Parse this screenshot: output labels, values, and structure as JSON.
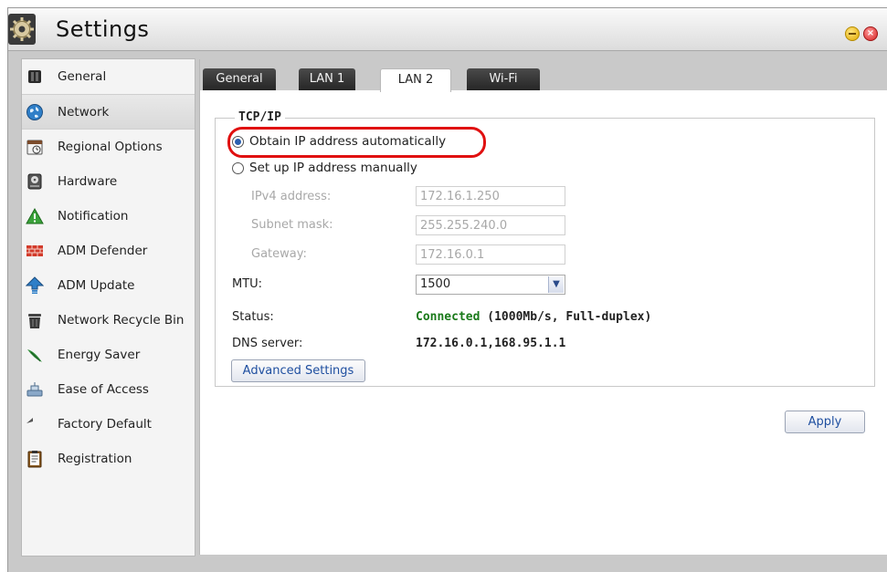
{
  "window": {
    "title": "Settings"
  },
  "sidebar": {
    "items": [
      {
        "label": "General",
        "icon": "server-icon",
        "active": false
      },
      {
        "label": "Network",
        "icon": "globe-icon",
        "active": true
      },
      {
        "label": "Regional Options",
        "icon": "clock-icon",
        "active": false
      },
      {
        "label": "Hardware",
        "icon": "disk-icon",
        "active": false
      },
      {
        "label": "Notification",
        "icon": "warning-icon",
        "active": false
      },
      {
        "label": "ADM Defender",
        "icon": "firewall-icon",
        "active": false
      },
      {
        "label": "ADM Update",
        "icon": "up-arrow-icon",
        "active": false
      },
      {
        "label": "Network Recycle Bin",
        "icon": "trash-icon",
        "active": false
      },
      {
        "label": "Energy Saver",
        "icon": "leaf-icon",
        "active": false
      },
      {
        "label": "Ease of Access",
        "icon": "router-icon",
        "active": false
      },
      {
        "label": "Factory Default",
        "icon": "undo-arrow-icon",
        "active": false
      },
      {
        "label": "Registration",
        "icon": "clipboard-icon",
        "active": false
      }
    ]
  },
  "tabs": [
    {
      "label": "General",
      "active": false
    },
    {
      "label": "LAN 1",
      "active": false
    },
    {
      "label": "LAN 2",
      "active": true
    },
    {
      "label": "Wi-Fi",
      "active": false
    }
  ],
  "tcpip": {
    "legend": "TCP/IP",
    "auto_label": "Obtain IP address automatically",
    "auto_selected": true,
    "manual_label": "Set up IP address manually",
    "ipv4_label": "IPv4 address:",
    "ipv4_value": "172.16.1.250",
    "subnet_label": "Subnet mask:",
    "subnet_value": "255.255.240.0",
    "gateway_label": "Gateway:",
    "gateway_value": "172.16.0.1",
    "mtu_label": "MTU:",
    "mtu_value": "1500",
    "status_label": "Status:",
    "status_connected": "Connected",
    "status_detail": "(1000Mb/s, Full-duplex)",
    "dns_label": "DNS server:",
    "dns_value": "172.16.0.1,168.95.1.1",
    "advanced_button": "Advanced Settings"
  },
  "apply_button": "Apply",
  "colors": {
    "connected": "#1a7a1a",
    "highlight": "#e01010",
    "link_blue": "#1f4fa0"
  }
}
